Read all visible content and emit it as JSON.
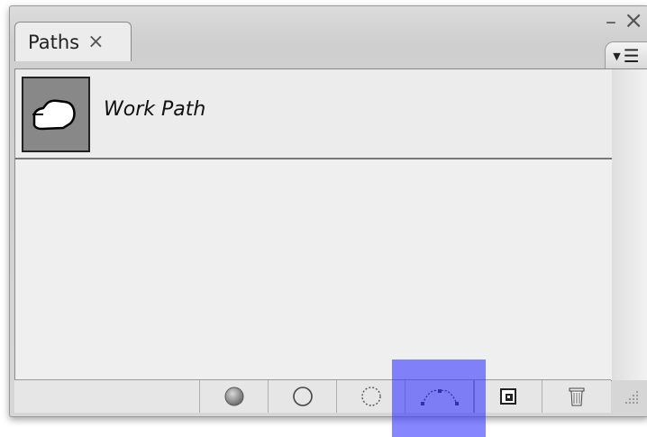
{
  "panel": {
    "tab": {
      "label": "Paths",
      "close_glyph": "×"
    },
    "window_controls": {
      "minimize_glyph": "–",
      "close_glyph": "×"
    },
    "menu_button": {
      "icon": "panel-menu-icon"
    }
  },
  "paths": [
    {
      "name": "Work Path",
      "thumbnail_icon": "hand-shape-icon"
    }
  ],
  "toolbar": {
    "buttons": [
      {
        "name": "fill-path-button",
        "icon": "filled-circle-icon"
      },
      {
        "name": "stroke-path-button",
        "icon": "outline-circle-icon"
      },
      {
        "name": "load-as-selection-button",
        "icon": "dotted-circle-icon"
      },
      {
        "name": "make-work-path-button",
        "icon": "work-path-icon",
        "highlighted": true
      },
      {
        "name": "new-path-button",
        "icon": "new-path-icon"
      },
      {
        "name": "delete-path-button",
        "icon": "trash-icon"
      }
    ]
  },
  "colors": {
    "highlight": "#3c3cff",
    "thumbnail_bg": "#888888"
  }
}
